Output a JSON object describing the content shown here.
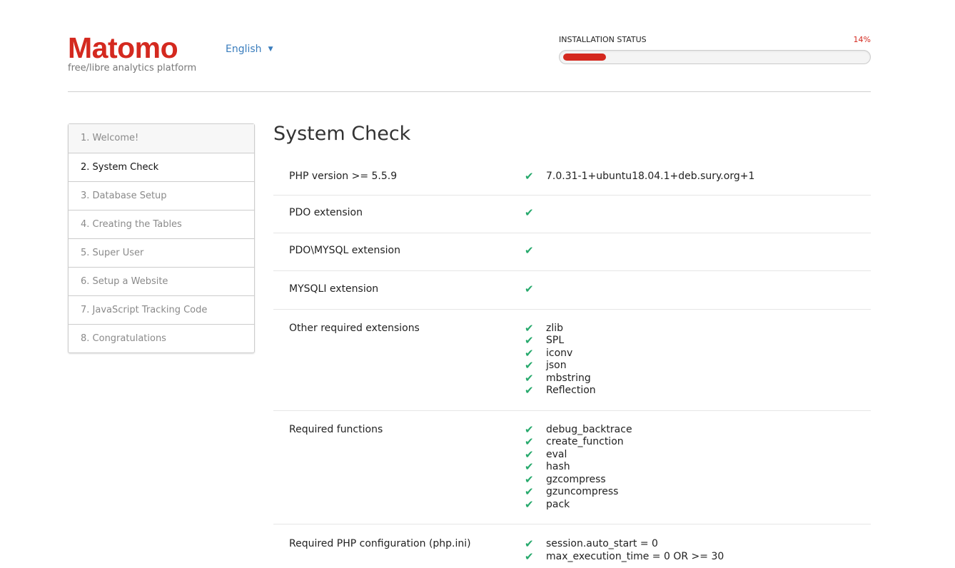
{
  "header": {
    "logo_text": "Matomo",
    "tagline": "free/libre analytics platform",
    "language": "English",
    "status_title": "INSTALLATION STATUS",
    "status_percent_label": "14%",
    "progress_fraction": 0.14
  },
  "colors": {
    "brand": "#d4291f",
    "link": "#3a7dbd",
    "ok": "#26a96c"
  },
  "steps": [
    {
      "label": "1. Welcome!"
    },
    {
      "label": "2. System Check"
    },
    {
      "label": "3. Database Setup"
    },
    {
      "label": "4. Creating the Tables"
    },
    {
      "label": "5. Super User"
    },
    {
      "label": "6. Setup a Website"
    },
    {
      "label": "7. JavaScript Tracking Code"
    },
    {
      "label": "8. Congratulations"
    }
  ],
  "active_step": 1,
  "main": {
    "title": "System Check",
    "checks": [
      {
        "label": "PHP version >= 5.5.9",
        "values": [
          "7.0.31-1+ubuntu18.04.1+deb.sury.org+1"
        ]
      },
      {
        "label": "PDO extension",
        "values": [
          ""
        ]
      },
      {
        "label": "PDO\\MYSQL extension",
        "values": [
          ""
        ]
      },
      {
        "label": "MYSQLI extension",
        "values": [
          ""
        ]
      },
      {
        "label": "Other required extensions",
        "values": [
          "zlib",
          "SPL",
          "iconv",
          "json",
          "mbstring",
          "Reflection"
        ]
      },
      {
        "label": "Required functions",
        "values": [
          "debug_backtrace",
          "create_function",
          "eval",
          "hash",
          "gzcompress",
          "gzuncompress",
          "pack"
        ]
      },
      {
        "label": "Required PHP configuration (php.ini)",
        "values": [
          "session.auto_start = 0",
          "max_execution_time = 0 OR >= 30"
        ]
      }
    ]
  },
  "icons": {
    "check": "check-icon",
    "caret": "caret-down-icon"
  }
}
